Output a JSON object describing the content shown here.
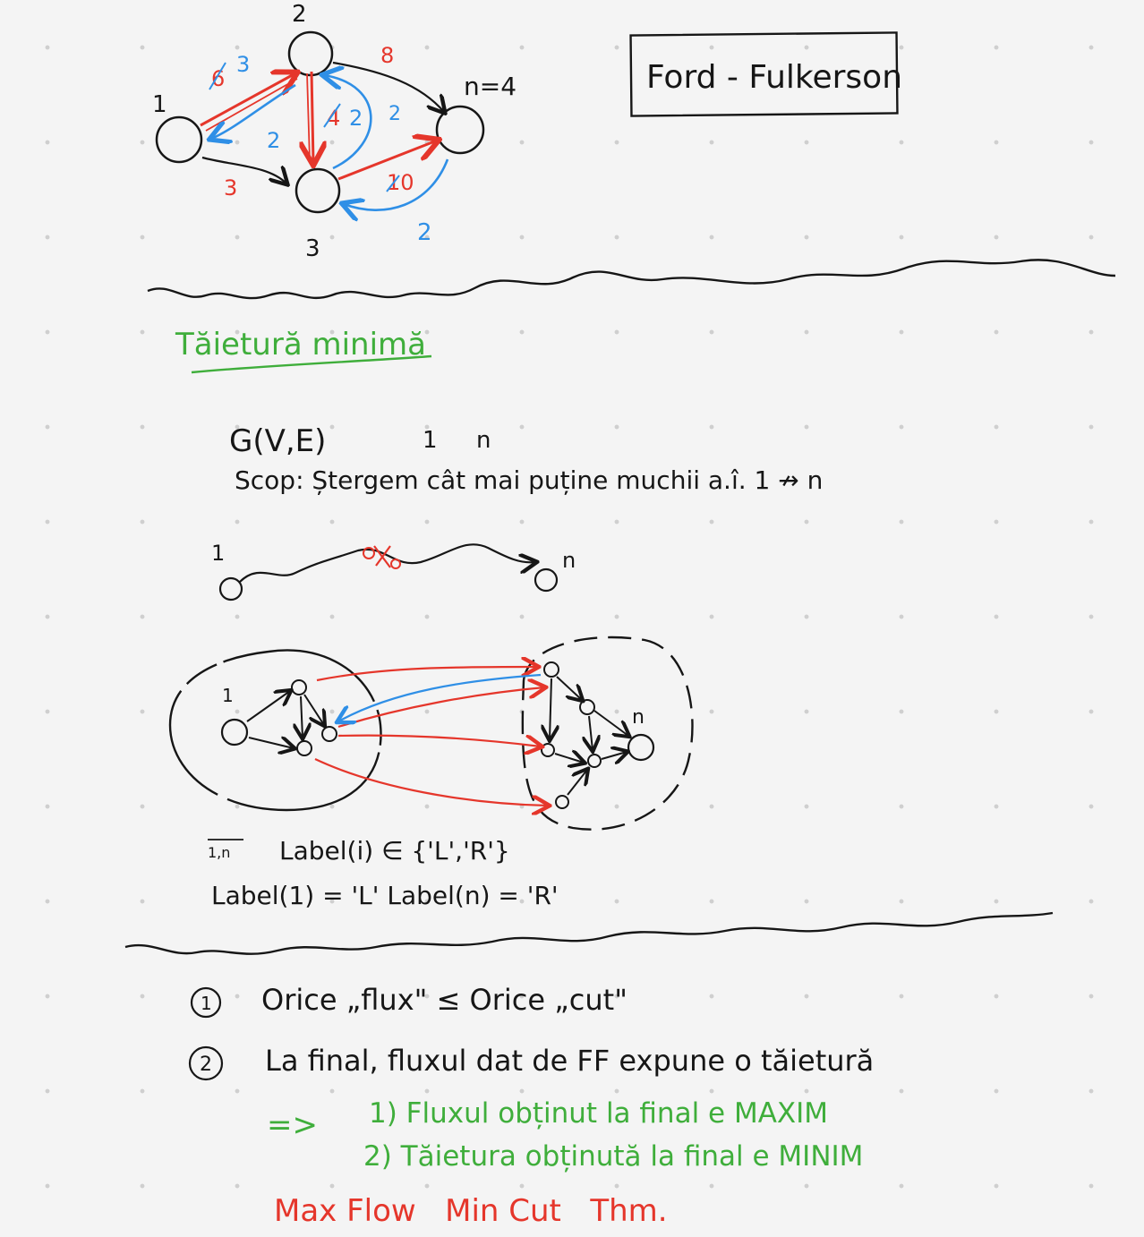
{
  "colors": {
    "ink": "#161616",
    "red": "#e5362b",
    "blue": "#2f8fe6",
    "green": "#3fae3b",
    "background": "#f4f4f4"
  },
  "graph": {
    "node_1": "1",
    "node_2": "2",
    "node_3": "3",
    "n_label": "n=4",
    "w_1_2_old": "6",
    "w_1_2_new": "3",
    "w_2_1_back": "2",
    "w_2_3_old": "4",
    "w_2_3_new": "2",
    "w_3_2_back": "2",
    "w_2_4": "8",
    "w_1_3": "3",
    "w_3_4": "10",
    "w_4_3_back": "2"
  },
  "title_box": "Ford - Fulkerson",
  "section_title": "Tăietură minimă",
  "problem": {
    "graph_expr": "G(V,E)",
    "source": "1",
    "sink": "n",
    "goal": "Scop: Ștergem cât mai puține muchii a.î. 1 ↛ n"
  },
  "path_diagram": {
    "start": "1",
    "end": "n"
  },
  "cut_diagram": {
    "left_source": "1",
    "right_sink": "n"
  },
  "labels": {
    "range": "1,n",
    "line1": "Label(i) ∈ {'L','R'}",
    "line2": "Label(1) = 'L'   Label(n) = 'R'"
  },
  "theorems": {
    "t1_num": "1",
    "t1": "Orice „flux\" ≤ Orice „cut\"",
    "t2_num": "2",
    "t2": "La final, fluxul dat de FF expune o tăietură",
    "implies": "=>",
    "c1": "1) Fluxul obținut la final e MAXIM",
    "c2": "2) Tăietura obținută la final e MINIM",
    "name": "Max Flow   Min Cut   Thm."
  }
}
